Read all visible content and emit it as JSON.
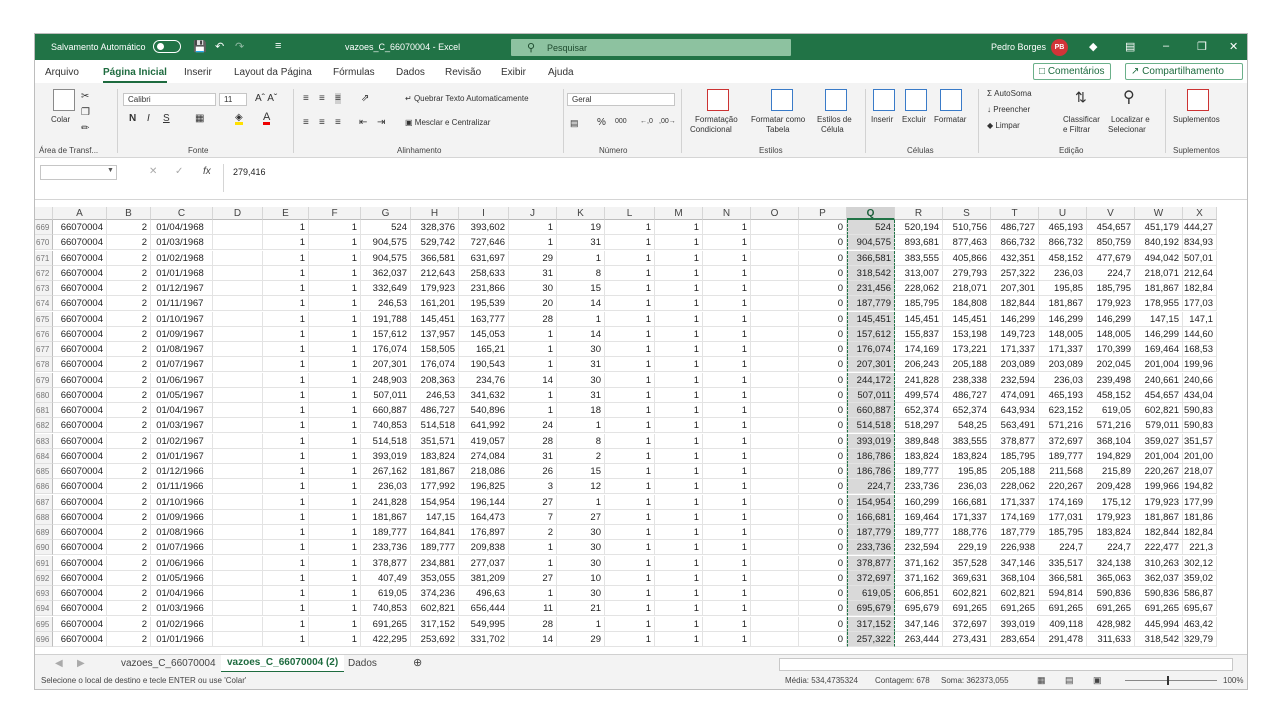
{
  "titlebar": {
    "autosave_label": "Salvamento Automático",
    "file_title": "vazoes_C_66070004 - Excel",
    "search_placeholder": "Pesquisar",
    "user_name": "Pedro Borges",
    "user_initials": "PB"
  },
  "menu": {
    "tabs": [
      "Arquivo",
      "Página Inicial",
      "Inserir",
      "Layout da Página",
      "Fórmulas",
      "Dados",
      "Revisão",
      "Exibir",
      "Ajuda"
    ],
    "active": "Página Inicial",
    "comments_label": "Comentários",
    "share_label": "Compartilhamento"
  },
  "ribbon": {
    "paste_label": "Colar",
    "font_name": "Calibri",
    "font_size": "11",
    "wrap_text": "Quebrar Texto Automaticamente",
    "merge_center": "Mesclar e Centralizar",
    "number_format": "Geral",
    "cond_format_1": "Formatação",
    "cond_format_2": "Condicional",
    "format_table_1": "Formatar como",
    "format_table_2": "Tabela",
    "cell_styles_1": "Estilos de",
    "cell_styles_2": "Célula",
    "insert_label": "Inserir",
    "delete_label": "Excluir",
    "format_label": "Formatar",
    "autosum_label": "AutoSoma",
    "fill_label": "Preencher",
    "clear_label": "Limpar",
    "sort_filter_1": "Classificar",
    "sort_filter_2": "e Filtrar",
    "find_select_1": "Localizar e",
    "find_select_2": "Selecionar",
    "addins_label": "Suplementos",
    "groups": {
      "clipboard": "Área de Transf...",
      "font": "Fonte",
      "alignment": "Alinhamento",
      "number": "Número",
      "styles": "Estilos",
      "cells": "Células",
      "editing": "Edição",
      "addins": "Suplementos"
    }
  },
  "formula_bar": {
    "name_box": "",
    "formula": "279,416"
  },
  "grid": {
    "columns": [
      "A",
      "B",
      "C",
      "D",
      "E",
      "F",
      "G",
      "H",
      "I",
      "J",
      "K",
      "L",
      "M",
      "N",
      "O",
      "P",
      "Q",
      "R",
      "S",
      "T",
      "U",
      "V",
      "W",
      "X"
    ],
    "selected_column": "Q",
    "rows": [
      {
        "n": "669",
        "cells": [
          "66070004",
          "2",
          "01/04/1968",
          "",
          "1",
          "1",
          "524",
          "328,376",
          "393,602",
          "1",
          "19",
          "1",
          "1",
          "1",
          "",
          "0",
          "524",
          "520,194",
          "510,756",
          "486,727",
          "465,193",
          "454,657",
          "451,179",
          "444,27"
        ]
      },
      {
        "n": "670",
        "cells": [
          "66070004",
          "2",
          "01/03/1968",
          "",
          "1",
          "1",
          "904,575",
          "529,742",
          "727,646",
          "1",
          "31",
          "1",
          "1",
          "1",
          "",
          "0",
          "904,575",
          "893,681",
          "877,463",
          "866,732",
          "866,732",
          "850,759",
          "840,192",
          "834,93"
        ]
      },
      {
        "n": "671",
        "cells": [
          "66070004",
          "2",
          "01/02/1968",
          "",
          "1",
          "1",
          "904,575",
          "366,581",
          "631,697",
          "29",
          "1",
          "1",
          "1",
          "1",
          "",
          "0",
          "366,581",
          "383,555",
          "405,866",
          "432,351",
          "458,152",
          "477,679",
          "494,042",
          "507,01"
        ]
      },
      {
        "n": "672",
        "cells": [
          "66070004",
          "2",
          "01/01/1968",
          "",
          "1",
          "1",
          "362,037",
          "212,643",
          "258,633",
          "31",
          "8",
          "1",
          "1",
          "1",
          "",
          "0",
          "318,542",
          "313,007",
          "279,793",
          "257,322",
          "236,03",
          "224,7",
          "218,071",
          "212,64"
        ]
      },
      {
        "n": "673",
        "cells": [
          "66070004",
          "2",
          "01/12/1967",
          "",
          "1",
          "1",
          "332,649",
          "179,923",
          "231,866",
          "30",
          "15",
          "1",
          "1",
          "1",
          "",
          "0",
          "231,456",
          "228,062",
          "218,071",
          "207,301",
          "195,85",
          "185,795",
          "181,867",
          "182,84"
        ]
      },
      {
        "n": "674",
        "cells": [
          "66070004",
          "2",
          "01/11/1967",
          "",
          "1",
          "1",
          "246,53",
          "161,201",
          "195,539",
          "20",
          "14",
          "1",
          "1",
          "1",
          "",
          "0",
          "187,779",
          "185,795",
          "184,808",
          "182,844",
          "181,867",
          "179,923",
          "178,955",
          "177,03"
        ]
      },
      {
        "n": "675",
        "cells": [
          "66070004",
          "2",
          "01/10/1967",
          "",
          "1",
          "1",
          "191,788",
          "145,451",
          "163,777",
          "28",
          "1",
          "1",
          "1",
          "1",
          "",
          "0",
          "145,451",
          "145,451",
          "145,451",
          "146,299",
          "146,299",
          "146,299",
          "147,15",
          "147,1"
        ]
      },
      {
        "n": "676",
        "cells": [
          "66070004",
          "2",
          "01/09/1967",
          "",
          "1",
          "1",
          "157,612",
          "137,957",
          "145,053",
          "1",
          "14",
          "1",
          "1",
          "1",
          "",
          "0",
          "157,612",
          "155,837",
          "153,198",
          "149,723",
          "148,005",
          "148,005",
          "146,299",
          "144,60"
        ]
      },
      {
        "n": "677",
        "cells": [
          "66070004",
          "2",
          "01/08/1967",
          "",
          "1",
          "1",
          "176,074",
          "158,505",
          "165,21",
          "1",
          "30",
          "1",
          "1",
          "1",
          "",
          "0",
          "176,074",
          "174,169",
          "173,221",
          "171,337",
          "171,337",
          "170,399",
          "169,464",
          "168,53"
        ]
      },
      {
        "n": "678",
        "cells": [
          "66070004",
          "2",
          "01/07/1967",
          "",
          "1",
          "1",
          "207,301",
          "176,074",
          "190,543",
          "1",
          "31",
          "1",
          "1",
          "1",
          "",
          "0",
          "207,301",
          "206,243",
          "205,188",
          "203,089",
          "203,089",
          "202,045",
          "201,004",
          "199,96"
        ]
      },
      {
        "n": "679",
        "cells": [
          "66070004",
          "2",
          "01/06/1967",
          "",
          "1",
          "1",
          "248,903",
          "208,363",
          "234,76",
          "14",
          "30",
          "1",
          "1",
          "1",
          "",
          "0",
          "244,172",
          "241,828",
          "238,338",
          "232,594",
          "236,03",
          "239,498",
          "240,661",
          "240,66"
        ]
      },
      {
        "n": "680",
        "cells": [
          "66070004",
          "2",
          "01/05/1967",
          "",
          "1",
          "1",
          "507,011",
          "246,53",
          "341,632",
          "1",
          "31",
          "1",
          "1",
          "1",
          "",
          "0",
          "507,011",
          "499,574",
          "486,727",
          "474,091",
          "465,193",
          "458,152",
          "454,657",
          "434,04"
        ]
      },
      {
        "n": "681",
        "cells": [
          "66070004",
          "2",
          "01/04/1967",
          "",
          "1",
          "1",
          "660,887",
          "486,727",
          "540,896",
          "1",
          "18",
          "1",
          "1",
          "1",
          "",
          "0",
          "660,887",
          "652,374",
          "652,374",
          "643,934",
          "623,152",
          "619,05",
          "602,821",
          "590,83"
        ]
      },
      {
        "n": "682",
        "cells": [
          "66070004",
          "2",
          "01/03/1967",
          "",
          "1",
          "1",
          "740,853",
          "514,518",
          "641,992",
          "24",
          "1",
          "1",
          "1",
          "1",
          "",
          "0",
          "514,518",
          "518,297",
          "548,25",
          "563,491",
          "571,216",
          "571,216",
          "579,011",
          "590,83"
        ]
      },
      {
        "n": "683",
        "cells": [
          "66070004",
          "2",
          "01/02/1967",
          "",
          "1",
          "1",
          "514,518",
          "351,571",
          "419,057",
          "28",
          "8",
          "1",
          "1",
          "1",
          "",
          "0",
          "393,019",
          "389,848",
          "383,555",
          "378,877",
          "372,697",
          "368,104",
          "359,027",
          "351,57"
        ]
      },
      {
        "n": "684",
        "cells": [
          "66070004",
          "2",
          "01/01/1967",
          "",
          "1",
          "1",
          "393,019",
          "183,824",
          "274,084",
          "31",
          "2",
          "1",
          "1",
          "1",
          "",
          "0",
          "186,786",
          "183,824",
          "183,824",
          "185,795",
          "189,777",
          "194,829",
          "201,004",
          "201,00"
        ]
      },
      {
        "n": "685",
        "cells": [
          "66070004",
          "2",
          "01/12/1966",
          "",
          "1",
          "1",
          "267,162",
          "181,867",
          "218,086",
          "26",
          "15",
          "1",
          "1",
          "1",
          "",
          "0",
          "186,786",
          "189,777",
          "195,85",
          "205,188",
          "211,568",
          "215,89",
          "220,267",
          "218,07"
        ]
      },
      {
        "n": "686",
        "cells": [
          "66070004",
          "2",
          "01/11/1966",
          "",
          "1",
          "1",
          "236,03",
          "177,992",
          "196,825",
          "3",
          "12",
          "1",
          "1",
          "1",
          "",
          "0",
          "224,7",
          "233,736",
          "236,03",
          "228,062",
          "220,267",
          "209,428",
          "199,966",
          "194,82"
        ]
      },
      {
        "n": "687",
        "cells": [
          "66070004",
          "2",
          "01/10/1966",
          "",
          "1",
          "1",
          "241,828",
          "154,954",
          "196,144",
          "27",
          "1",
          "1",
          "1",
          "1",
          "",
          "0",
          "154,954",
          "160,299",
          "166,681",
          "171,337",
          "174,169",
          "175,12",
          "179,923",
          "177,99"
        ]
      },
      {
        "n": "688",
        "cells": [
          "66070004",
          "2",
          "01/09/1966",
          "",
          "1",
          "1",
          "181,867",
          "147,15",
          "164,473",
          "7",
          "27",
          "1",
          "1",
          "1",
          "",
          "0",
          "166,681",
          "169,464",
          "171,337",
          "174,169",
          "177,031",
          "179,923",
          "181,867",
          "181,86"
        ]
      },
      {
        "n": "689",
        "cells": [
          "66070004",
          "2",
          "01/08/1966",
          "",
          "1",
          "1",
          "189,777",
          "164,841",
          "176,897",
          "2",
          "30",
          "1",
          "1",
          "1",
          "",
          "0",
          "187,779",
          "189,777",
          "188,776",
          "187,779",
          "185,795",
          "183,824",
          "182,844",
          "182,84"
        ]
      },
      {
        "n": "690",
        "cells": [
          "66070004",
          "2",
          "01/07/1966",
          "",
          "1",
          "1",
          "233,736",
          "189,777",
          "209,838",
          "1",
          "30",
          "1",
          "1",
          "1",
          "",
          "0",
          "233,736",
          "232,594",
          "229,19",
          "226,938",
          "224,7",
          "224,7",
          "222,477",
          "221,3"
        ]
      },
      {
        "n": "691",
        "cells": [
          "66070004",
          "2",
          "01/06/1966",
          "",
          "1",
          "1",
          "378,877",
          "234,881",
          "277,037",
          "1",
          "30",
          "1",
          "1",
          "1",
          "",
          "0",
          "378,877",
          "371,162",
          "357,528",
          "347,146",
          "335,517",
          "324,138",
          "310,263",
          "302,12"
        ]
      },
      {
        "n": "692",
        "cells": [
          "66070004",
          "2",
          "01/05/1966",
          "",
          "1",
          "1",
          "407,49",
          "353,055",
          "381,209",
          "27",
          "10",
          "1",
          "1",
          "1",
          "",
          "0",
          "372,697",
          "371,162",
          "369,631",
          "368,104",
          "366,581",
          "365,063",
          "362,037",
          "359,02"
        ]
      },
      {
        "n": "693",
        "cells": [
          "66070004",
          "2",
          "01/04/1966",
          "",
          "1",
          "1",
          "619,05",
          "374,236",
          "496,63",
          "1",
          "30",
          "1",
          "1",
          "1",
          "",
          "0",
          "619,05",
          "606,851",
          "602,821",
          "602,821",
          "594,814",
          "590,836",
          "590,836",
          "586,87"
        ]
      },
      {
        "n": "694",
        "cells": [
          "66070004",
          "2",
          "01/03/1966",
          "",
          "1",
          "1",
          "740,853",
          "602,821",
          "656,444",
          "11",
          "21",
          "1",
          "1",
          "1",
          "",
          "0",
          "695,679",
          "695,679",
          "691,265",
          "691,265",
          "691,265",
          "691,265",
          "691,265",
          "695,67"
        ]
      },
      {
        "n": "695",
        "cells": [
          "66070004",
          "2",
          "01/02/1966",
          "",
          "1",
          "1",
          "691,265",
          "317,152",
          "549,995",
          "28",
          "1",
          "1",
          "1",
          "1",
          "",
          "0",
          "317,152",
          "347,146",
          "372,697",
          "393,019",
          "409,118",
          "428,982",
          "445,994",
          "463,42"
        ]
      },
      {
        "n": "696",
        "cells": [
          "66070004",
          "2",
          "01/01/1966",
          "",
          "1",
          "1",
          "422,295",
          "253,692",
          "331,702",
          "14",
          "29",
          "1",
          "1",
          "1",
          "",
          "0",
          "257,322",
          "263,444",
          "273,431",
          "283,654",
          "291,478",
          "311,633",
          "318,542",
          "329,79"
        ]
      }
    ]
  },
  "sheet_tabs": {
    "tabs": [
      "vazoes_C_66070004",
      "vazoes_C_66070004 (2)",
      "Dados"
    ],
    "active": "vazoes_C_66070004 (2)"
  },
  "status_bar": {
    "message": "Selecione o local de destino e tecle ENTER ou use 'Colar'",
    "average": "Média: 534,4735324",
    "count": "Contagem: 678",
    "sum": "Soma: 362373,055",
    "zoom": "100%"
  },
  "colors": {
    "excel_green": "#217346",
    "selection_border": "#217346"
  }
}
